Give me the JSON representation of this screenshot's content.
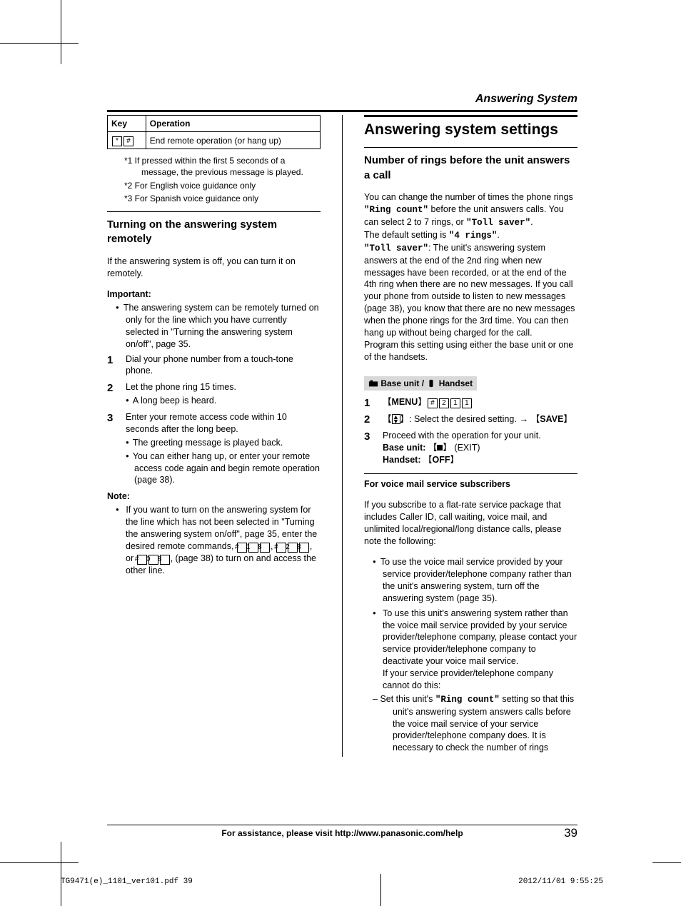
{
  "chapter_title": "Answering System",
  "table": {
    "headers": [
      "Key",
      "Operation"
    ],
    "row_key_symbols": [
      "*",
      "#"
    ],
    "row_operation": "End remote operation (or hang up)"
  },
  "footnotes": {
    "f1": "*1   If pressed within the first 5 seconds of a message, the previous message is played.",
    "f2": "*2   For English voice guidance only",
    "f3": "*3   For Spanish voice guidance only"
  },
  "left": {
    "heading": "Turning on the answering system remotely",
    "intro": "If the answering system is off, you can turn it on remotely.",
    "important_label": "Important:",
    "important_bullet": "The answering system can be remotely turned on only for the line which you have currently selected in \"Turning the answering system on/off\", page 35.",
    "step1": "Dial your phone number from a touch-tone phone.",
    "step2": "Let the phone ring 15 times.",
    "step2_sub": "A long beep is heard.",
    "step3": "Enter your remote access code within 10 seconds after the long beep.",
    "step3_sub1": "The greeting message is played back.",
    "step3_sub2": "You can either hang up, or enter your remote access code again and begin remote operation (page 38).",
    "note_label": "Note:",
    "note_text_a": "If you want to turn on the answering system for the line which has not been selected in \"Turning the answering system on/off\", page 35, enter the desired remote commands, ",
    "note_text_b": ", (page 38) to turn on and access the other line."
  },
  "right": {
    "main_heading": "Answering system settings",
    "sub_heading": "Number of rings before the unit answers a call",
    "para1a": "You can change the number of times the phone rings ",
    "ring_count_q": "\"Ring count\"",
    "para1b": " before the unit answers calls. You can select 2 to 7 rings, or ",
    "toll_saver_q": "\"Toll saver\"",
    "period": ".",
    "default_a": "The default setting is ",
    "default_b": "\"4 rings\"",
    "toll_saver_label": "\"Toll saver\"",
    "toll_desc": ": The unit's answering system answers at the end of the 2nd ring when new messages have been recorded, or at the end of the 4th ring when there are no new messages. If you call your phone from outside to listen to new messages (page 38), you know that there are no new messages when the phone rings for the 3rd time. You can then hang up without being charged for the call.",
    "program_note": "Program this setting using either the base unit or one of the handsets.",
    "device_label_a": "Base unit /",
    "device_label_b": "Handset",
    "step1_menu": "MENU",
    "step1_code": [
      "#",
      "2",
      "1",
      "1"
    ],
    "step2_a": ": Select the desired setting. ",
    "step2_save": "SAVE",
    "step3": "Proceed with the operation for your unit.",
    "step3_base_label": "Base unit: ",
    "step3_base_exit": " (EXIT)",
    "step3_handset_label": "Handset: ",
    "step3_handset_off": "OFF",
    "voicemail_heading": "For voice mail service subscribers",
    "voicemail_intro": "If you subscribe to a flat-rate service package that includes Caller ID, call waiting, voice mail, and unlimited local/regional/long distance calls, please note the following:",
    "vm_b1": "To use the voice mail service provided by your service provider/telephone company rather than the unit's answering system, turn off the answering system (page 35).",
    "vm_b2a": "To use this unit's answering system rather than the voice mail service provided by your service provider/telephone company, please contact your service provider/telephone company to deactivate your voice mail service.",
    "vm_b2b": "If your service provider/telephone company cannot do this:",
    "vm_dash_a": "Set this unit's ",
    "vm_dash_b": " setting so that this unit's answering system answers calls before the voice mail service of your service provider/telephone company does. It is necessary to check the number of rings"
  },
  "footer_text": "For assistance, please visit http://www.panasonic.com/help",
  "page_number": "39",
  "print_left": "TG9471(e)_1101_ver101.pdf   39",
  "print_right": "2012/11/01   9:55:25"
}
